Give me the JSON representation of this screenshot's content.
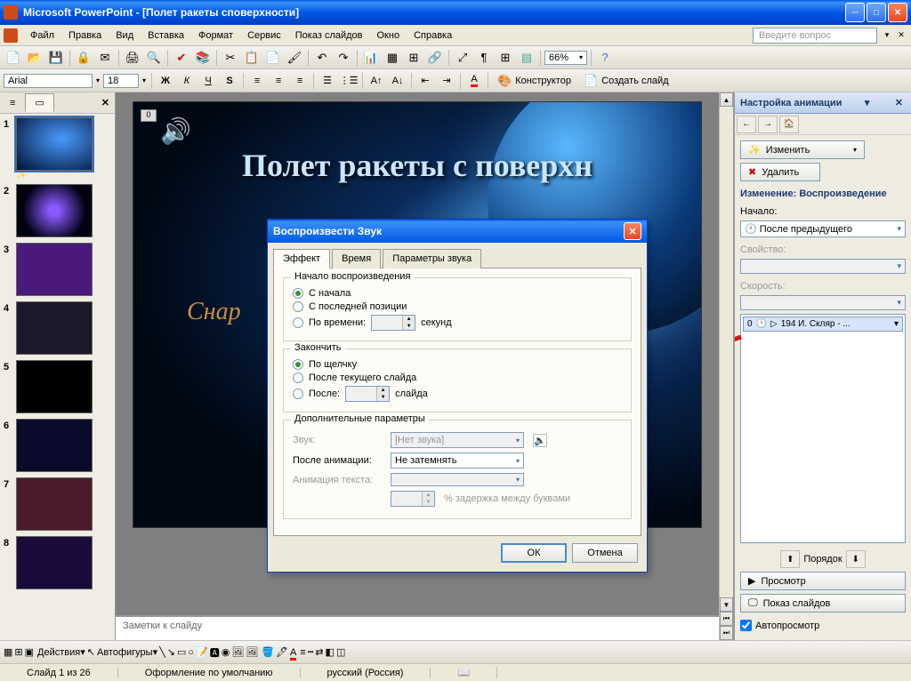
{
  "title": "Microsoft PowerPoint - [Полет ракеты споверхности]",
  "menubar": {
    "items": [
      "Файл",
      "Правка",
      "Вид",
      "Вставка",
      "Формат",
      "Сервис",
      "Показ слайдов",
      "Окно",
      "Справка"
    ],
    "question_placeholder": "Введите вопрос"
  },
  "toolbar2": {
    "font": "Arial",
    "size": "18",
    "zoom": "66%",
    "design_label": "Конструктор",
    "new_slide_label": "Создать слайд"
  },
  "slidepanel": {
    "tab_outline": "≡",
    "tab_slides": "▭",
    "slide_numbers": [
      "1",
      "2",
      "3",
      "4",
      "5",
      "6",
      "7",
      "8"
    ]
  },
  "slide": {
    "placeholder_num": "0",
    "title": "Полет ракеты с поверхн",
    "subtitle": "Снар"
  },
  "notes": {
    "placeholder": "Заметки к слайду"
  },
  "taskpane": {
    "title": "Настройка анимации",
    "change_btn": "Изменить",
    "delete_btn": "Удалить",
    "section_label": "Изменение: Воспроизведение",
    "start_label": "Начало:",
    "start_value": "После предыдущего",
    "property_label": "Свойство:",
    "speed_label": "Скорость:",
    "list_item": "194 И. Скляр - ...",
    "list_item_num": "0",
    "order_label": "Порядок",
    "preview_btn": "Просмотр",
    "slideshow_btn": "Показ слайдов",
    "autopreview": "Автопросмотр"
  },
  "dialog": {
    "title": "Воспроизвести Звук",
    "tabs": [
      "Эффект",
      "Время",
      "Параметры звука"
    ],
    "start_group": "Начало воспроизведения",
    "start_from_begin": "С начала",
    "start_from_last": "С последней позиции",
    "start_by_time": "По времени:",
    "seconds": "секунд",
    "stop_group": "Закончить",
    "stop_on_click": "По щелчку",
    "stop_after_current": "После текущего слайда",
    "stop_after": "После:",
    "slides_unit": "слайда",
    "extra_group": "Дополнительные параметры",
    "sound_label": "Звук:",
    "sound_value": "[Нет звука]",
    "after_anim_label": "После анимации:",
    "after_anim_value": "Не затемнять",
    "text_anim_label": "Анимация текста:",
    "delay_label": "% задержка между буквами",
    "ok": "ОК",
    "cancel": "Отмена"
  },
  "bottombar": {
    "actions": "Действия",
    "autoshapes": "Автофигуры"
  },
  "statusbar": {
    "slide_info": "Слайд 1 из 26",
    "design": "Оформление по умолчанию",
    "lang": "русский (Россия)"
  }
}
